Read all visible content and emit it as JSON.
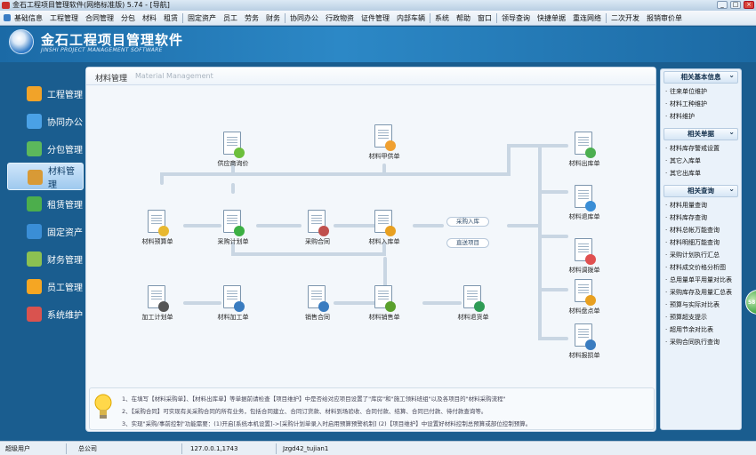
{
  "window": {
    "title": "金石工程项目管理软件(网络标准版) 5.74 - [导航]",
    "buttons": [
      "_",
      "□",
      "×"
    ]
  },
  "menu": [
    "基础信息",
    "工程管理",
    "合同管理",
    "分包",
    "材料",
    "租赁",
    "固定资产",
    "员工",
    "劳务",
    "财务",
    "协同办公",
    "行政物资",
    "证件管理",
    "内部车辆",
    "系统",
    "帮助",
    "窗口",
    "领导查询",
    "快捷单据",
    "重连网络",
    "二次开发",
    "报销审价单"
  ],
  "brand": {
    "title": "金石工程项目管理软件",
    "subtitle": "JINSHI PROJECT MANAGEMENT SOFTWARE"
  },
  "nav": [
    {
      "label": "工程管理",
      "icon": "worker-icon",
      "color": "#f1a329"
    },
    {
      "label": "协同办公",
      "icon": "office-icon",
      "color": "#4aa1e6"
    },
    {
      "label": "分包管理",
      "icon": "subcontract-icon",
      "color": "#5cb85c"
    },
    {
      "label": "材料管理",
      "icon": "material-box-icon",
      "color": "#d89a36",
      "active": true
    },
    {
      "label": "租赁管理",
      "icon": "lease-icon",
      "color": "#4cae4c"
    },
    {
      "label": "固定资产",
      "icon": "asset-icon",
      "color": "#3a8ed6"
    },
    {
      "label": "财务管理",
      "icon": "finance-icon",
      "color": "#8cc152"
    },
    {
      "label": "员工管理",
      "icon": "staff-icon",
      "color": "#f5a623"
    },
    {
      "label": "系统维护",
      "icon": "system-icon",
      "color": "#d9534f"
    }
  ],
  "main": {
    "title": "材料管理",
    "subtitle": "Material Management"
  },
  "flow": {
    "supplier_price": "供应商询价",
    "material_dispatch": "材料甲供单",
    "budget": "材料预算单",
    "purchase_plan": "采购计划单",
    "purchase_contract": "采购合同",
    "inbound": "材料入库单",
    "process_plan": "加工计划单",
    "process_order": "材料加工单",
    "sales_contract": "销售合同",
    "sales_order": "材料销售单",
    "return_order": "材料退货单",
    "outbound": "材料出库单",
    "out_return": "材料退库单",
    "transfer": "材料调拨单",
    "stock_check": "材料盘点单",
    "loss": "材料报损单",
    "pill_purchase_in": "采购入库",
    "pill_direct": "直送项目"
  },
  "side": {
    "basic_header": "相关基本信息",
    "basic": [
      "往来单位维护",
      "材料工种维护",
      "材料维护"
    ],
    "docs_header": "相关单据",
    "docs": [
      "材料库存警戒设置",
      "其它入库单",
      "其它出库单"
    ],
    "query_header": "相关查询",
    "query": [
      "材料用量查询",
      "材料库存查询",
      "材料总帐万能查询",
      "材料明细万能查询",
      "采购计划执行汇总",
      "材料成交价格分析图",
      "总用量单平用量对比表",
      "采购库存及用量汇总表",
      "预算与实际对比表",
      "预算超支提示",
      "超用节余对比表",
      "采购合同执行查询"
    ]
  },
  "tips": [
    "1、在填写【材料采购单】、【材料出库单】等单据前请检查【项目维护】中是否给对应项目设置了\"库房\"和\"施工领料班组\"以及各项目的\"材料采购流程\"",
    "2、【采购合同】可实现有关采购合同的所有业务，包括合同建立、合同订货款、材料到场验收、合同付款、结算、合同已付款、待付款查询等。",
    "3、实现\"采购/事前控制\"功能需要：(1)开启[系统本机设置]->[采购计划单录入时启用预算预警机制]  (2)【项目维护】中设置好材料控制总预算或部位控制预算。"
  ],
  "tip_link": "系统本机设置",
  "status": {
    "user": "超级用户",
    "company": "总公司",
    "ip": "127.0.0.1,1743",
    "db": "Jzgd42_tujian1"
  },
  "edge_button": "58"
}
